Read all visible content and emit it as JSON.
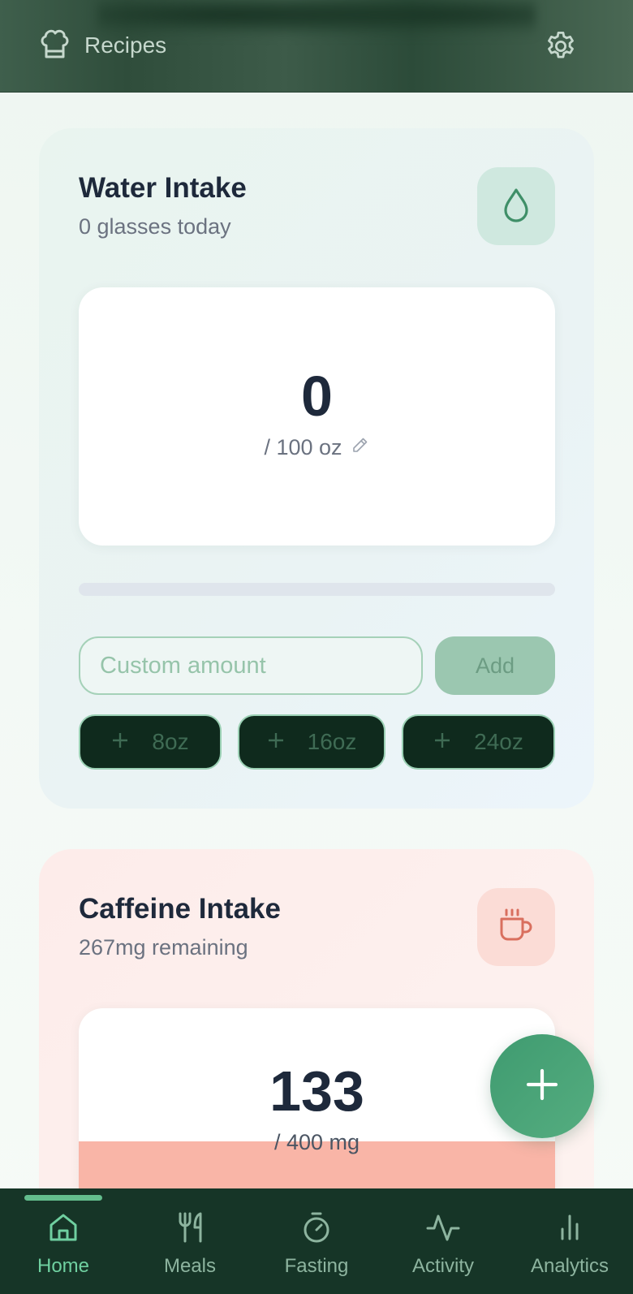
{
  "header": {
    "recipes_label": "Recipes",
    "recipes_icon": "chef-hat-icon",
    "settings_icon": "gear-icon"
  },
  "water": {
    "title": "Water Intake",
    "subtitle": "0 glasses today",
    "icon": "droplet-icon",
    "current": "0",
    "goal": "/ 100 oz",
    "goal_edit_icon": "pencil-icon",
    "progress_percent": 0,
    "custom_placeholder": "Custom amount",
    "add_label": "Add",
    "quick_add": [
      {
        "label": "8oz"
      },
      {
        "label": "16oz"
      },
      {
        "label": "24oz"
      }
    ]
  },
  "caffeine": {
    "title": "Caffeine Intake",
    "subtitle": "267mg remaining",
    "icon": "coffee-cup-icon",
    "current": "133",
    "goal": "/ 400 mg",
    "progress_fraction": 0.3325
  },
  "fab": {
    "icon": "plus-icon"
  },
  "nav": {
    "items": [
      {
        "label": "Home",
        "icon": "home-icon",
        "active": true
      },
      {
        "label": "Meals",
        "icon": "utensils-icon",
        "active": false
      },
      {
        "label": "Fasting",
        "icon": "stopwatch-icon",
        "active": false
      },
      {
        "label": "Activity",
        "icon": "activity-pulse-icon",
        "active": false
      },
      {
        "label": "Analytics",
        "icon": "bar-chart-icon",
        "active": false
      }
    ]
  },
  "colors": {
    "brand_green": "#4a9a71",
    "nav_bg": "#163527",
    "caffeine_accent": "#f9b5a7"
  }
}
